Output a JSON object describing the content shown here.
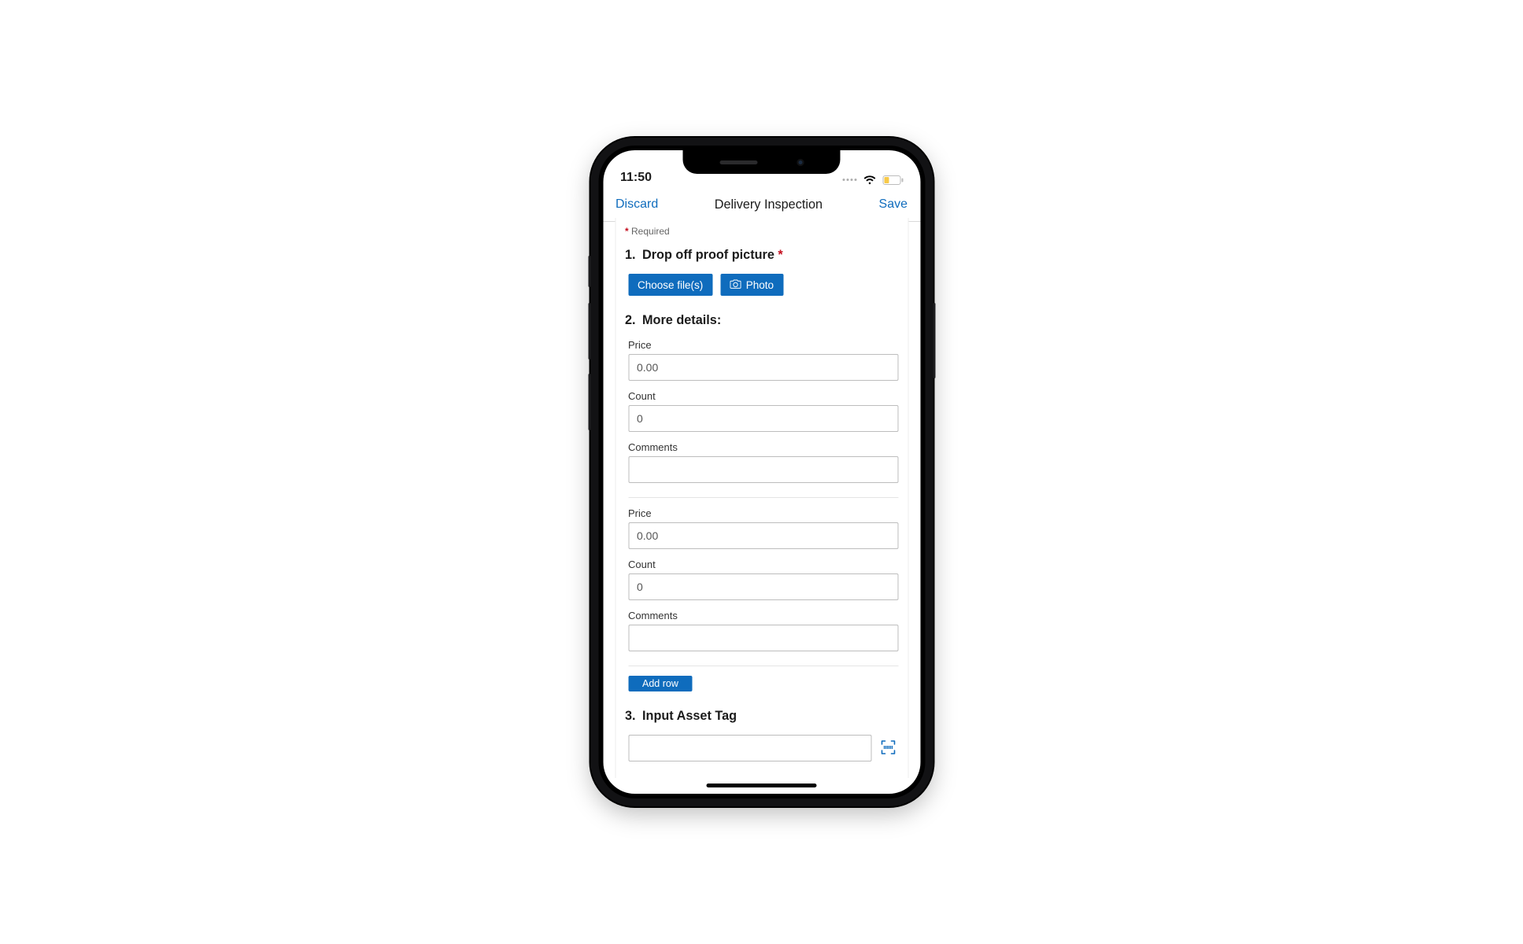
{
  "status": {
    "time": "11:50"
  },
  "nav": {
    "left": "Discard",
    "title": "Delivery Inspection",
    "right": "Save"
  },
  "required_label": "Required",
  "q1": {
    "num": "1.",
    "title": "Drop off proof picture",
    "required": "*",
    "choose_btn": "Choose file(s)",
    "photo_btn": "Photo"
  },
  "q2": {
    "num": "2.",
    "title": "More details:",
    "labels": {
      "price": "Price",
      "count": "Count",
      "comments": "Comments"
    },
    "rows": [
      {
        "price": "0.00",
        "count": "0",
        "comments": ""
      },
      {
        "price": "0.00",
        "count": "0",
        "comments": ""
      }
    ],
    "add_row": "Add row"
  },
  "q3": {
    "num": "3.",
    "title": "Input Asset Tag",
    "value": ""
  }
}
